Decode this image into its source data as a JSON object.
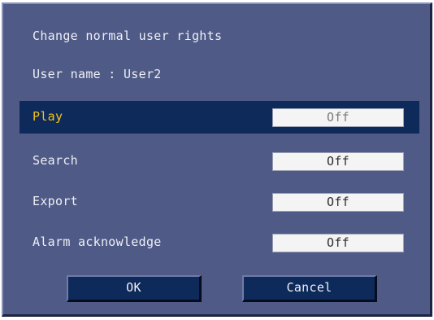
{
  "dialog": {
    "title": "Change normal user rights",
    "user_name_text": "User name : User2"
  },
  "rights": [
    {
      "label": "Play",
      "value": "Off",
      "selected": true
    },
    {
      "label": "Search",
      "value": "Off",
      "selected": false
    },
    {
      "label": "Export",
      "value": "Off",
      "selected": false
    },
    {
      "label": "Alarm acknowledge",
      "value": "Off",
      "selected": false
    }
  ],
  "buttons": {
    "ok_label": "OK",
    "cancel_label": "Cancel"
  },
  "colors": {
    "panel_background": "#4f5a86",
    "selected_row_background": "#0e2a5a",
    "selected_label_color": "#f0c419",
    "button_background": "#0e2a5a",
    "value_box_background": "#f4f4f4"
  }
}
